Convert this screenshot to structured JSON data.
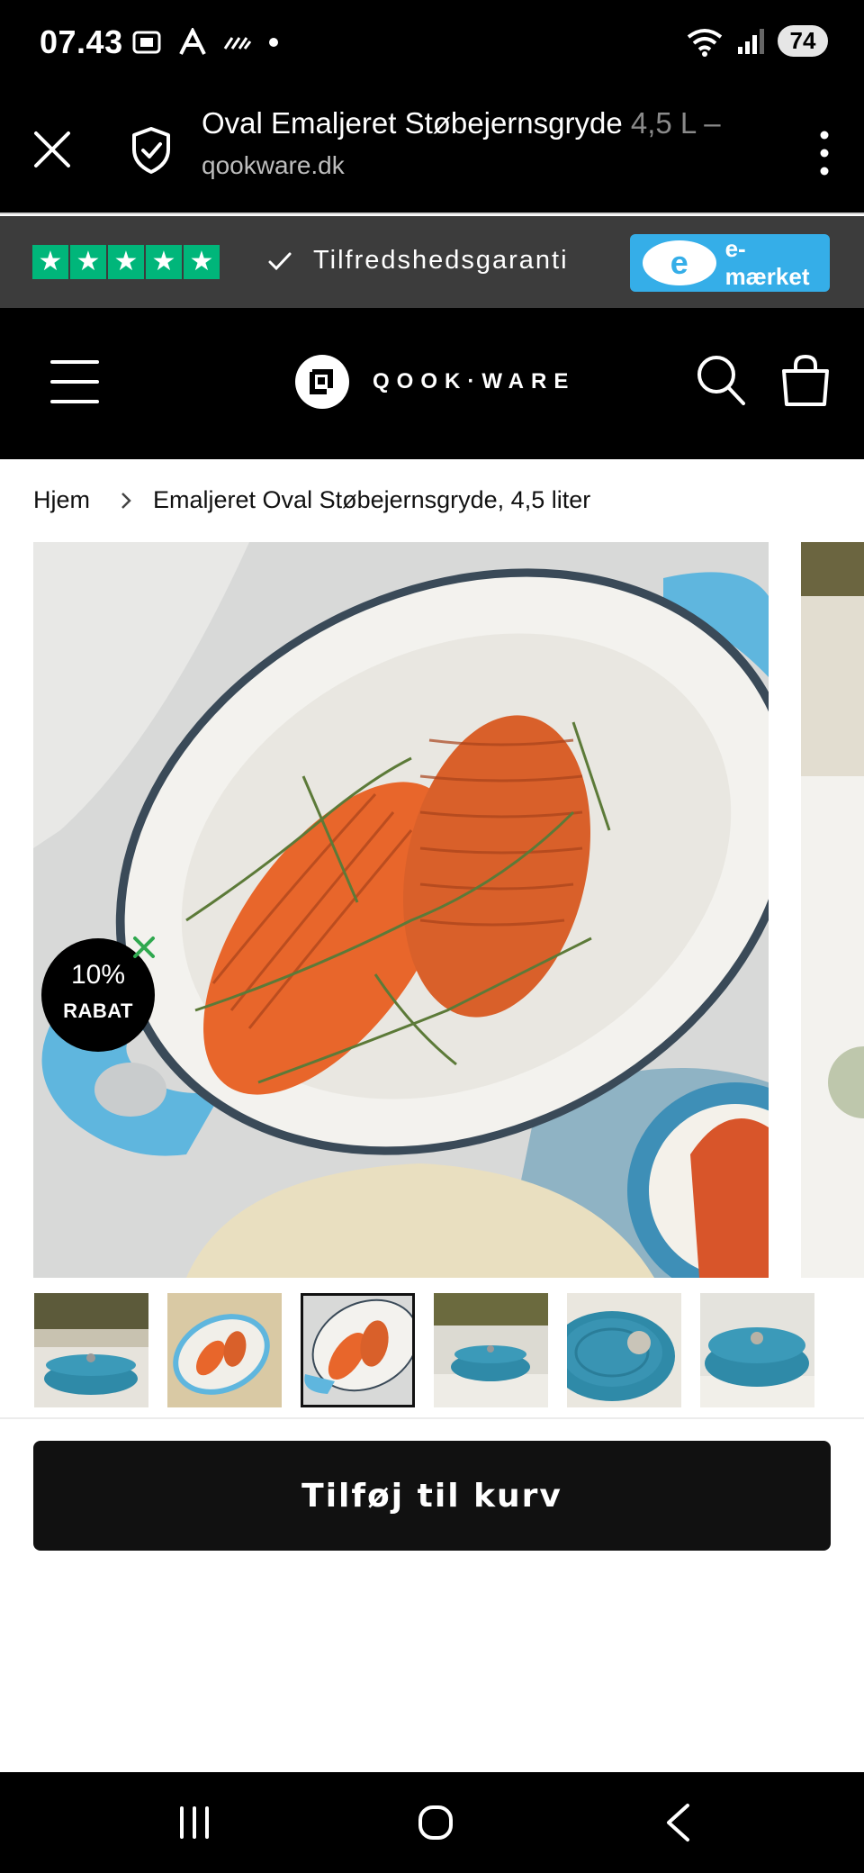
{
  "status": {
    "time": "07.43",
    "battery": "74"
  },
  "browser": {
    "title": "Oval Emaljeret Støbejernsgryde",
    "title_suffix": "4,5 L –",
    "url": "qookware.dk"
  },
  "trust": {
    "rating_stars": 5,
    "guarantee": "Tilfredshedsgaranti",
    "emaerket_label": "e-mærket",
    "colors": {
      "trustpilot_green": "#00b67a",
      "emaerket_blue": "#35aee8"
    }
  },
  "header": {
    "logo_text": "QOOK·WARE"
  },
  "breadcrumb": {
    "home": "Hjem",
    "current": "Emaljeret Oval Støbejernsgryde, 4,5 liter"
  },
  "product": {
    "badge_percent": "10%",
    "badge_label": "RABAT",
    "thumbnails": [
      "pot-front",
      "hasselback-overhead",
      "hasselback-closeup",
      "pot-kitchen",
      "lid-closeup",
      "pot-table"
    ],
    "active_thumbnail": 2
  },
  "cta": {
    "add_to_cart": "Tilføj til kurv"
  }
}
